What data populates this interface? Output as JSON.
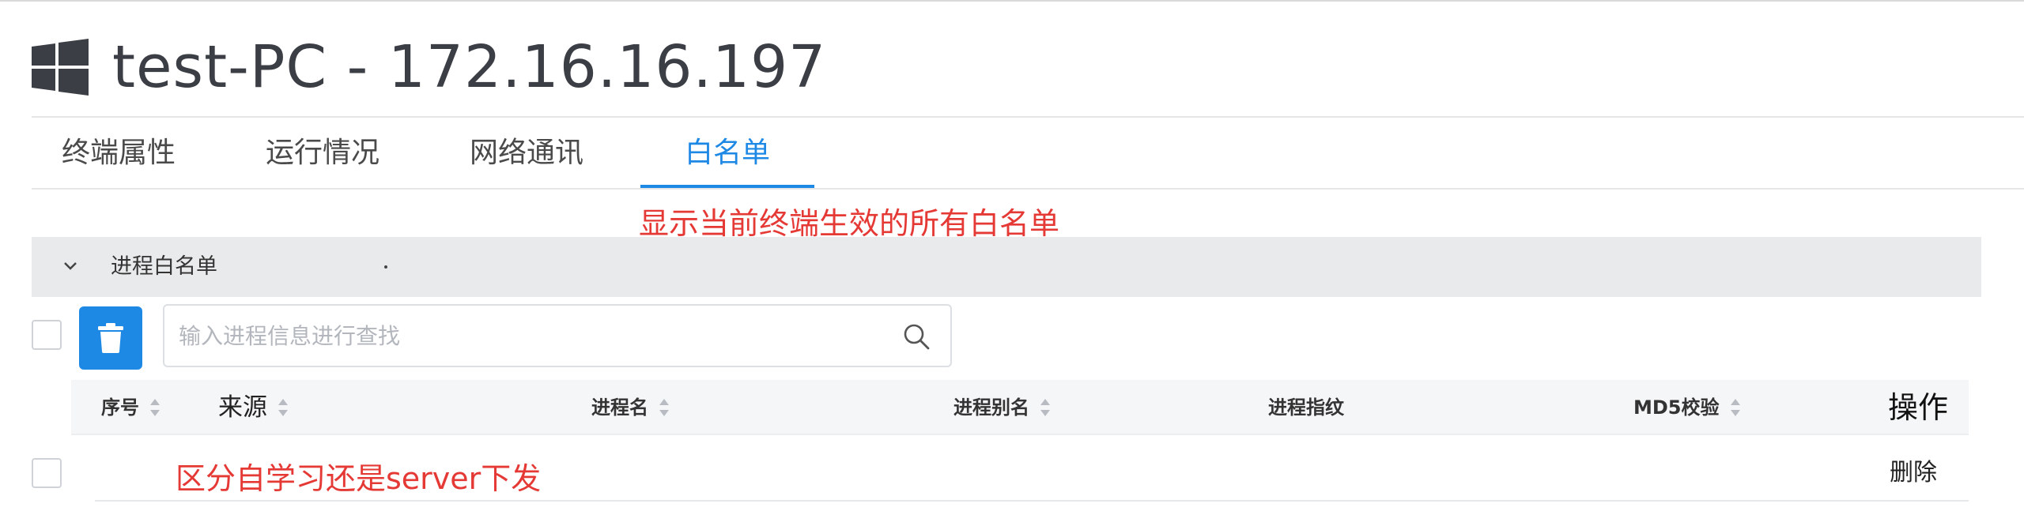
{
  "header": {
    "title": "test-PC - 172.16.16.197",
    "icon": "windows-logo-icon"
  },
  "tabs": [
    {
      "label": "终端属性",
      "active": false
    },
    {
      "label": "运行情况",
      "active": false
    },
    {
      "label": "网络通讯",
      "active": false
    },
    {
      "label": "白名单",
      "active": true
    }
  ],
  "annotations": {
    "top": "显示当前终端生效的所有白名单",
    "row": "区分自学习还是server下发"
  },
  "section": {
    "title": "进程白名单",
    "icon": "chevron-down-icon"
  },
  "toolbar": {
    "delete_icon": "trash-icon",
    "search_placeholder": "输入进程信息进行查找",
    "search_value": ""
  },
  "table": {
    "columns": {
      "seq": "序号",
      "source": "来源",
      "process_name": "进程名",
      "process_alias": "进程别名",
      "process_fingerprint": "进程指纹",
      "md5": "MD5校验",
      "ops": "操作"
    },
    "rows": [
      {
        "action": "删除"
      }
    ]
  },
  "colors": {
    "accent": "#1e88e5",
    "annotation": "#e53935",
    "section_bg": "#e9eaeb"
  }
}
